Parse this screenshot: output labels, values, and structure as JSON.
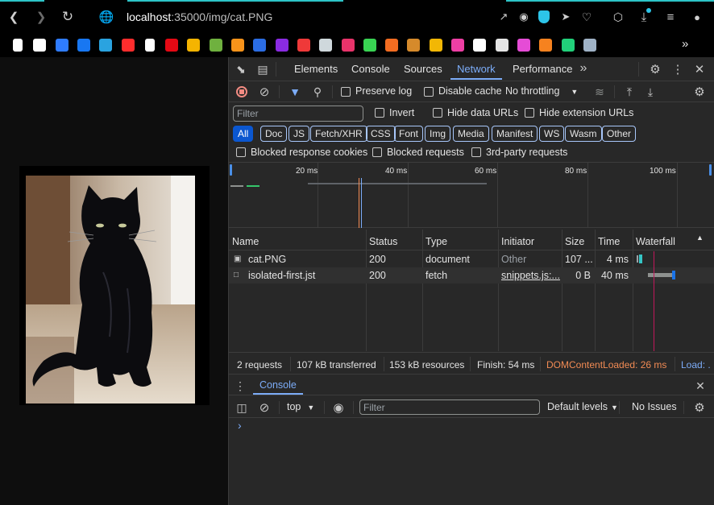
{
  "browser": {
    "url_host": "localhost",
    "url_path": ":35000/img/cat.PNG",
    "nav": {
      "back_icon": "arrow-left-icon",
      "forward_icon": "arrow-right-icon",
      "reload_icon": "reload-icon",
      "site_icon": "globe-icon"
    },
    "toolbar_icons": [
      "share-icon",
      "camera-icon",
      "shield-icon",
      "send-icon",
      "heart-icon",
      "cube-icon",
      "download-icon",
      "menu-icon",
      "profile-icon"
    ],
    "more_bookmarks": "»"
  },
  "bookmarks": [
    {
      "name": "page-icon",
      "color": "#ffffff"
    },
    {
      "name": "sparkle-icon",
      "color": "#ffffff"
    },
    {
      "name": "a-logo-icon",
      "color": "#2f7cff"
    },
    {
      "name": "facebook-icon",
      "color": "#1877f2"
    },
    {
      "name": "telegram-icon",
      "color": "#2aa3e0"
    },
    {
      "name": "play-icon",
      "color": "#ff2d2d"
    },
    {
      "name": "page-icon",
      "color": "#ffffff"
    },
    {
      "name": "netflix-icon",
      "color": "#e50914"
    },
    {
      "name": "brush-icon",
      "color": "#f5b400"
    },
    {
      "name": "chess-icon",
      "color": "#6fb13f"
    },
    {
      "name": "coin-icon",
      "color": "#f7931a"
    },
    {
      "name": "paypal-icon",
      "color": "#2b6de3"
    },
    {
      "name": "diamond-icon",
      "color": "#8a2be2"
    },
    {
      "name": "vivaldi-icon",
      "color": "#ef3939"
    },
    {
      "name": "sword-icon",
      "color": "#cfd8dc"
    },
    {
      "name": "arc-icon",
      "color": "#e8336a"
    },
    {
      "name": "s-logo-icon",
      "color": "#39d353"
    },
    {
      "name": "brand-icon",
      "color": "#f36c21"
    },
    {
      "name": "lion-icon",
      "color": "#d68a2b"
    },
    {
      "name": "chart-icon",
      "color": "#f2b705"
    },
    {
      "name": "tf-icon",
      "color": "#ee3fa4"
    },
    {
      "name": "cube-logo-icon",
      "color": "#ffffff"
    },
    {
      "name": "bar-icon",
      "color": "#e4e4e4"
    },
    {
      "name": "t-logo-icon",
      "color": "#e54cd6"
    },
    {
      "name": "bolt-icon",
      "color": "#f6821f"
    },
    {
      "name": "star-icon",
      "color": "#21d07a"
    },
    {
      "name": "steam-icon",
      "color": "#9fb2c6"
    }
  ],
  "devtools": {
    "panel_tabs": [
      "Elements",
      "Console",
      "Sources",
      "Network",
      "Performance"
    ],
    "active_tab": "Network",
    "overflow_label": "»",
    "toolbar": {
      "preserve_log": "Preserve log",
      "disable_cache": "Disable cache",
      "throttling": "No throttling"
    },
    "filter": {
      "placeholder": "Filter",
      "invert": "Invert",
      "hide_data_urls": "Hide data URLs",
      "hide_extension_urls": "Hide extension URLs"
    },
    "type_filters": [
      "All",
      "Doc",
      "JS",
      "Fetch/XHR",
      "CSS",
      "Font",
      "Img",
      "Media",
      "Manifest",
      "WS",
      "Wasm",
      "Other"
    ],
    "active_type": "All",
    "blocked": {
      "response_cookies": "Blocked response cookies",
      "requests": "Blocked requests",
      "third_party": "3rd-party requests"
    },
    "overview_ticks": [
      "20 ms",
      "40 ms",
      "60 ms",
      "80 ms",
      "100 ms"
    ],
    "columns": [
      "Name",
      "Status",
      "Type",
      "Initiator",
      "Size",
      "Time",
      "Waterfall"
    ],
    "requests": [
      {
        "name": "cat.PNG",
        "status": "200",
        "type": "document",
        "initiator": "Other",
        "size": "107 ...",
        "time": "4 ms",
        "icon": "image-file-icon"
      },
      {
        "name": "isolated-first.jst",
        "status": "200",
        "type": "fetch",
        "initiator": "snippets.js:...",
        "size": "0 B",
        "time": "40 ms",
        "icon": "document-file-icon"
      }
    ],
    "summary": {
      "requests": "2 requests",
      "transferred": "107 kB transferred",
      "resources": "153 kB resources",
      "finish": "Finish: 54 ms",
      "dom_content_loaded": "DOMContentLoaded: 26 ms",
      "load": "Load: ."
    },
    "drawer": {
      "tab": "Console",
      "context": "top",
      "filter_placeholder": "Filter",
      "levels": "Default levels",
      "issues": "No Issues",
      "prompt": "›"
    },
    "colors": {
      "accent": "#7cacf8",
      "dcl": "#f28b54",
      "load_line": "#c2185b",
      "timing_blue": "#1a73e8"
    }
  }
}
